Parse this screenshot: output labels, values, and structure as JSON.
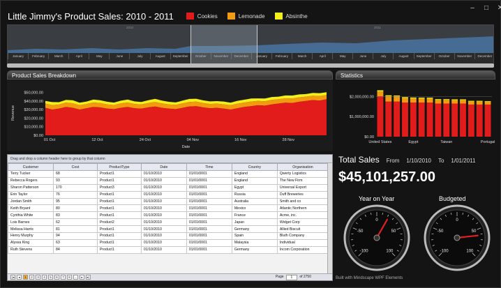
{
  "header": {
    "title": "Little Jimmy's Product Sales: 2010 - 2011",
    "legend": [
      {
        "label": "Cookies",
        "color": "#e21b1b"
      },
      {
        "label": "Lemonade",
        "color": "#f29b11"
      },
      {
        "label": "Absinthe",
        "color": "#f2ef1b"
      }
    ],
    "window_buttons": [
      "–",
      "□",
      "✕"
    ]
  },
  "overview": {
    "years": [
      "2010",
      "2011"
    ],
    "months": [
      "January",
      "February",
      "March",
      "April",
      "May",
      "June",
      "July",
      "August",
      "September",
      "October",
      "November",
      "December",
      "January",
      "February",
      "March",
      "April",
      "May",
      "June",
      "July",
      "August",
      "September",
      "October",
      "November",
      "December"
    ]
  },
  "breakdown": {
    "title": "Product Sales Breakdown",
    "chart_data": {
      "type": "area",
      "xlabel": "Date",
      "ylabel": "Revenue",
      "x_ticks": [
        "01 Oct",
        "12 Oct",
        "24 Oct",
        "04 Nov",
        "16 Nov",
        "28 Nov"
      ],
      "y_ticks": [
        "$0.00",
        "$10,000.00",
        "$20,000.00",
        "$30,000.00",
        "$40,000.00",
        "$50,000.00"
      ],
      "ylim": [
        0,
        52000
      ],
      "series": [
        {
          "name": "Cookies",
          "values": [
            32000,
            30000,
            31000,
            33000,
            32000,
            30000,
            31500,
            33000,
            32500,
            31000,
            30500,
            32000,
            33000,
            31500,
            31000,
            32500,
            33500,
            32000,
            31000,
            30500,
            32000,
            33500,
            34000,
            32500,
            31500,
            32000,
            31000,
            30000,
            31500,
            33000,
            34000,
            35000,
            34500,
            36000,
            37000,
            38000,
            37500,
            39000,
            40000,
            41000,
            40500,
            42000
          ]
        },
        {
          "name": "Lemonade",
          "values": [
            5000,
            5200,
            4800,
            5100,
            5300,
            5000,
            4900,
            5200,
            5100,
            5000,
            4800,
            5100,
            5200,
            5000,
            4900,
            5100,
            5300,
            5200,
            5000,
            4900,
            5100,
            5300,
            5200,
            5100,
            5000,
            4900,
            5100,
            5000,
            5200,
            5100,
            5300,
            5000,
            5100,
            5200,
            5000,
            5100,
            5300,
            5200,
            5000,
            5100,
            5200,
            5000
          ]
        },
        {
          "name": "Absinthe",
          "values": [
            3000,
            3500,
            2800,
            3200,
            3600,
            3000,
            2900,
            3400,
            3300,
            3100,
            2800,
            3200,
            3500,
            3000,
            2900,
            3300,
            3600,
            3200,
            3000,
            2900,
            3300,
            3500,
            3400,
            3100,
            3000,
            2900,
            3200,
            3000,
            3400,
            3300,
            3500,
            3000,
            3200,
            3400,
            3000,
            3300,
            3500,
            3400,
            3000,
            3200,
            3400,
            3100
          ]
        }
      ]
    }
  },
  "grid": {
    "group_hint": "Drag and drop a column header here to group by that column",
    "columns": [
      "Customer",
      "Cost",
      "ProductType",
      "Date",
      "Time",
      "Country",
      "Organisation"
    ],
    "rows": [
      [
        "Terry Tucker",
        "68",
        "Product1",
        "01/10/2010",
        "01/01/0001",
        "England",
        "Qwerty Logistics"
      ],
      [
        "Rebecca Rogers",
        "93",
        "Product1",
        "01/10/2010",
        "01/01/0001",
        "England",
        "The New Firm"
      ],
      [
        "Sharon Patterson",
        "170",
        "Product3",
        "01/10/2010",
        "01/01/0001",
        "Egypt",
        "Universal Export"
      ],
      [
        "Erin Taylor",
        "76",
        "Product1",
        "01/10/2010",
        "01/01/0001",
        "Russia",
        "Duff Breweries"
      ],
      [
        "Jordan Smith",
        "95",
        "Product1",
        "01/10/2010",
        "01/01/0001",
        "Australia",
        "Smith and co"
      ],
      [
        "Keith Bryant",
        "80",
        "Product1",
        "01/10/2010",
        "01/01/0001",
        "Mexico",
        "Atlantic Northern"
      ],
      [
        "Cynthia White",
        "83",
        "Product1",
        "01/10/2010",
        "01/01/0001",
        "France",
        "Acme, inc."
      ],
      [
        "Lois Barnes",
        "62",
        "Product2",
        "01/10/2010",
        "01/01/0001",
        "Japan",
        "Widget Corp"
      ],
      [
        "Melissa Harris",
        "81",
        "Product1",
        "01/10/2010",
        "01/01/0001",
        "Germany",
        "Allied Biscuit"
      ],
      [
        "Henry Murphy",
        "94",
        "Product1",
        "01/10/2010",
        "01/01/0001",
        "Spain",
        "Bluth Company"
      ],
      [
        "Alyssa King",
        "63",
        "Product1",
        "01/10/2010",
        "01/01/0001",
        "Malaysia",
        "Individual"
      ],
      [
        "Ruth Stevens",
        "84",
        "Product1",
        "01/10/2010",
        "01/01/0001",
        "Germany",
        "Incom Corporation"
      ]
    ],
    "pager": {
      "pages": [
        "1",
        "2",
        "3",
        "4",
        "5",
        "6",
        "7",
        "8",
        "..."
      ],
      "page_label": "Page",
      "page_value": "1",
      "of_label": "of 2750"
    }
  },
  "statistics": {
    "title": "Statistics",
    "chart_data": {
      "type": "bar",
      "y_ticks": [
        "$0.00",
        "$1,000,000.00",
        "$2,000,000.00"
      ],
      "ylim": [
        0,
        2500000
      ],
      "category_labels": [
        "United States",
        "Egypt",
        "Taiwan",
        "Portugal"
      ],
      "series": [
        {
          "name": "Cookies",
          "values": [
            2000000,
            1750000,
            1750000,
            1700000,
            1700000,
            1700000,
            1700000,
            1650000,
            1650000,
            1650000,
            1650000,
            1600000,
            1600000,
            1600000
          ]
        },
        {
          "name": "Lemonade",
          "values": [
            250000,
            250000,
            250000,
            220000,
            200000,
            200000,
            200000,
            180000,
            180000,
            170000,
            170000,
            150000,
            150000,
            140000
          ]
        },
        {
          "name": "Absinthe",
          "values": [
            60000,
            60000,
            50000,
            50000,
            50000,
            45000,
            45000,
            40000,
            40000,
            40000,
            40000,
            35000,
            35000,
            30000
          ]
        }
      ]
    },
    "total_label": "Total Sales",
    "from_label": "From",
    "from_date": "1/10/2010",
    "to_label": "To",
    "to_date": "1/01/2011",
    "total_value": "$45,101,257.00",
    "gauges": [
      {
        "label": "Year on Year",
        "value": 22,
        "ticks": [
          "-50",
          "0",
          "50",
          "100",
          "-100"
        ]
      },
      {
        "label": "Budgeted",
        "value": 62,
        "ticks": [
          "-50",
          "0",
          "50",
          "100",
          "-100"
        ]
      }
    ],
    "footer": "Built with Mindscape WPF Elements"
  }
}
